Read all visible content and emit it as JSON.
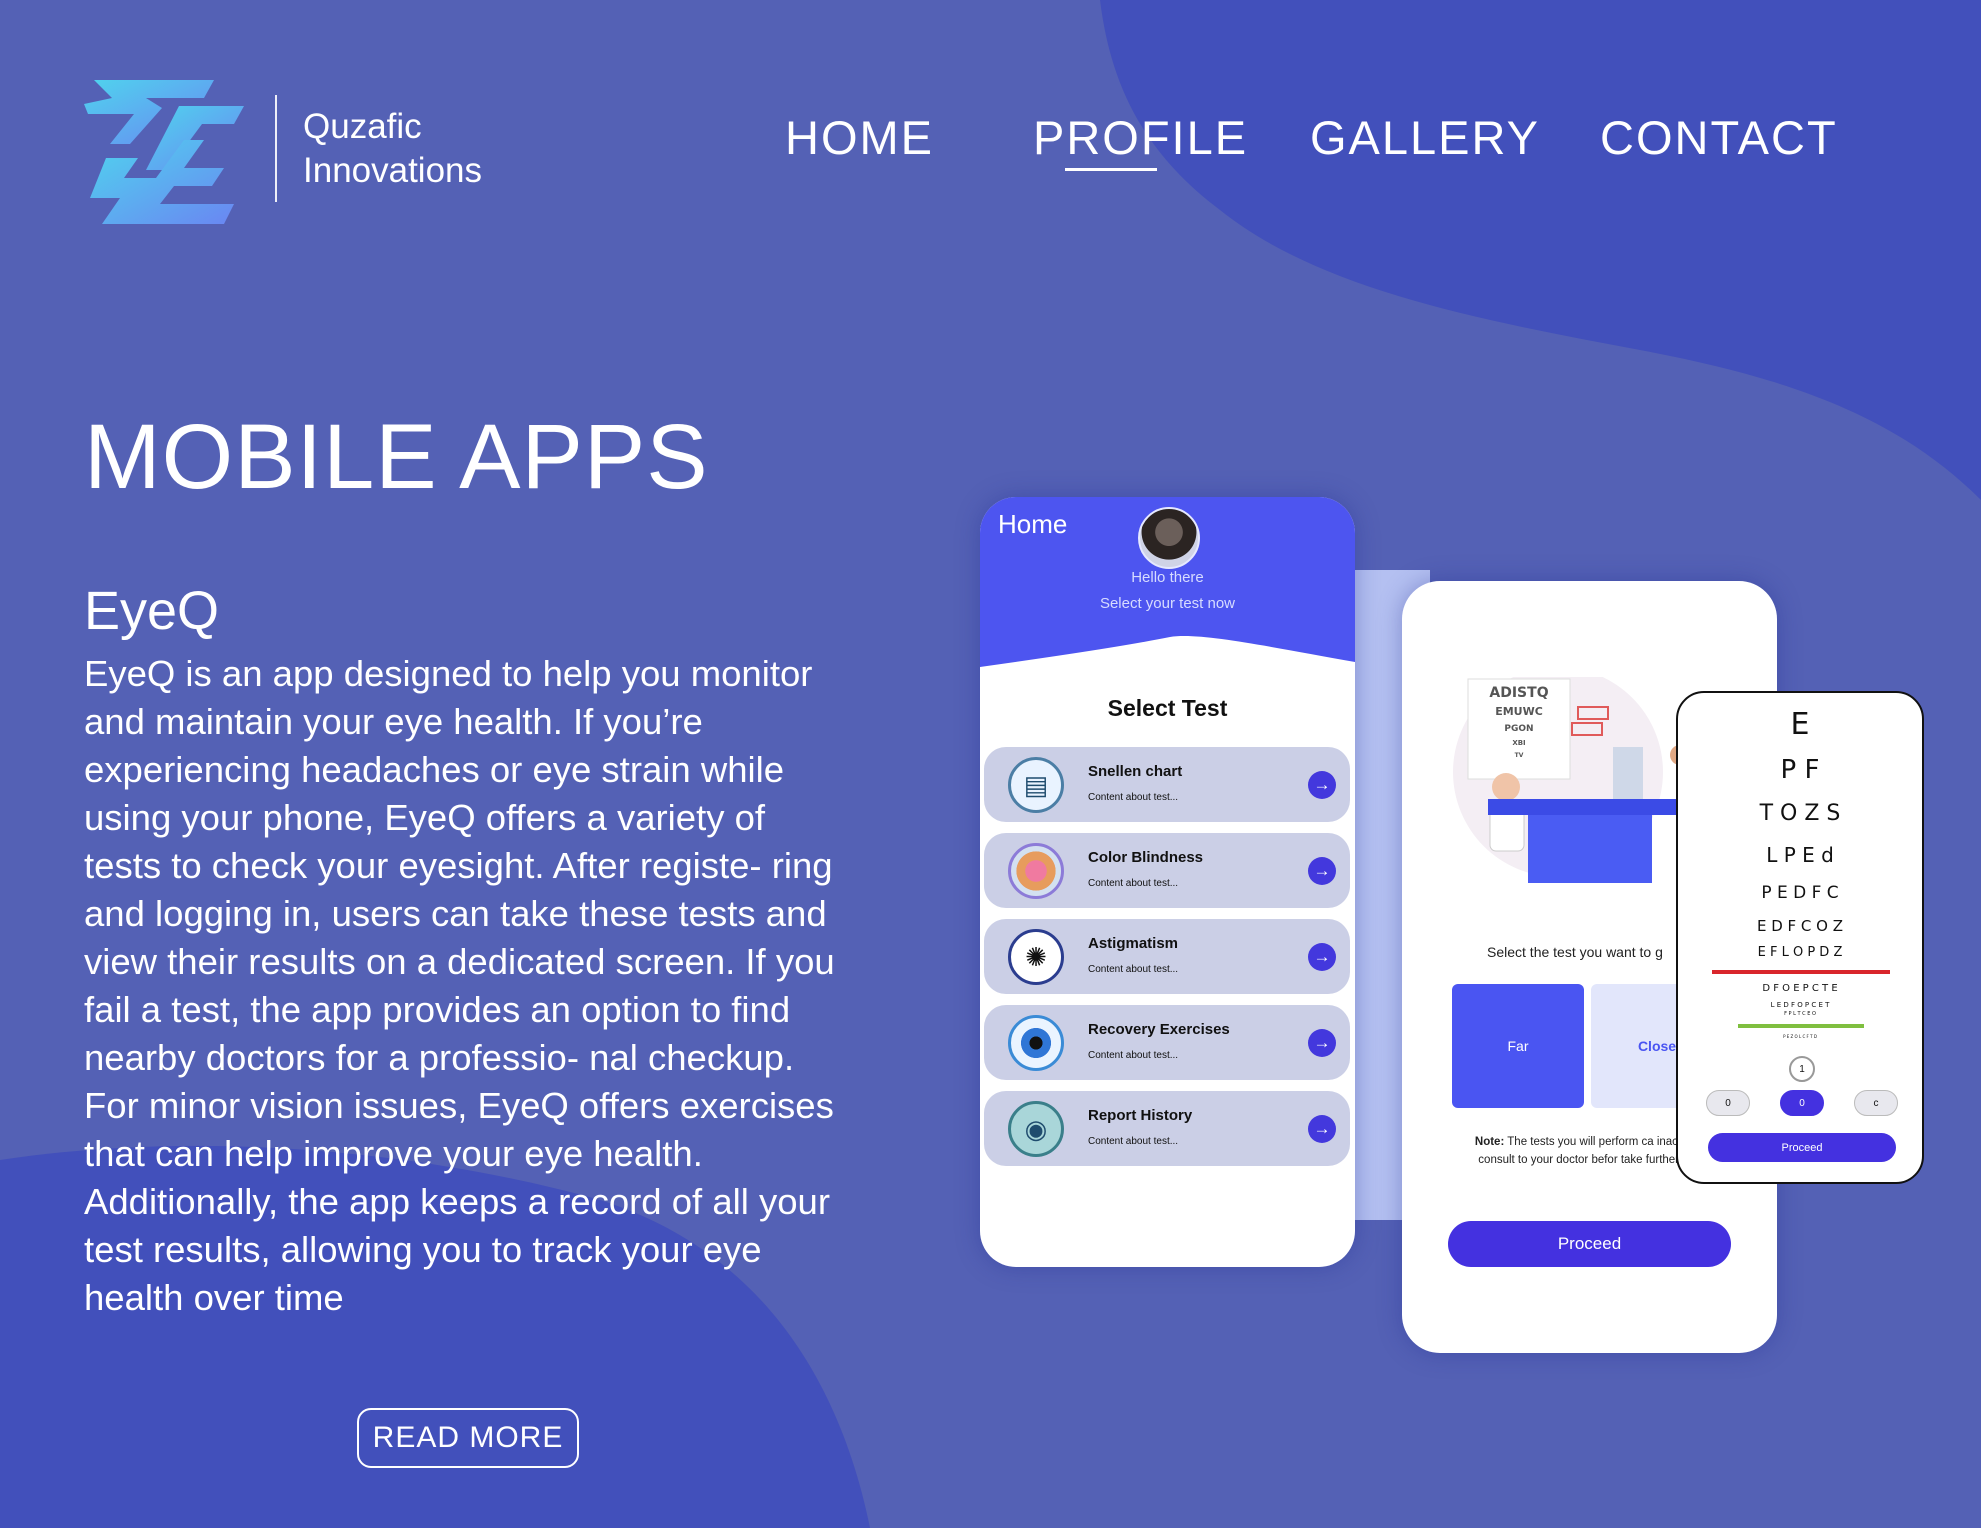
{
  "brand": {
    "line1": "Quzafic",
    "line2": "Innovations",
    "logo_icon": "qz-logo-icon"
  },
  "nav": {
    "home": "HOME",
    "profile": "PROFILE",
    "gallery": "GALLERY",
    "contact": "CONTACT",
    "active": "PROFILE"
  },
  "section": {
    "title": "MOBILE APPS",
    "app_name": "EyeQ",
    "description": "EyeQ is an app designed to help you monitor and maintain your eye health. If you’re experiencing headaches or eye strain while using your phone, EyeQ offers a variety of tests to check your eyesight. After registe- ring and logging in, users can take these tests and view their results on a dedicated screen. If you fail a test, the app provides an option to find nearby doctors for a professio- nal checkup. For minor vision issues, EyeQ offers exercises that can help improve your eye health. Additionally, the app keeps a record of all your test results, allowing you to track your eye health over time",
    "read_more": "READ MORE"
  },
  "phone1": {
    "title": "Home",
    "hello": "Hello there",
    "subtitle": "Select your test now",
    "select_heading": "Select Test",
    "tests": [
      {
        "name": "Snellen chart",
        "sub": "Content about test...",
        "icon": "snellen-chart-icon"
      },
      {
        "name": "Color Blindness",
        "sub": "Content about test...",
        "icon": "color-blindness-icon"
      },
      {
        "name": "Astigmatism",
        "sub": "Content about test...",
        "icon": "astigmatism-icon"
      },
      {
        "name": "Recovery Exercises",
        "sub": "Content about test...",
        "icon": "eye-icon"
      },
      {
        "name": "Report History",
        "sub": "Content about test...",
        "icon": "report-icon"
      }
    ]
  },
  "phone2": {
    "chart_letters": [
      "ADISTQ",
      "EMUWC",
      "PGON",
      "XBI",
      "TV"
    ],
    "select_text": "Select the test you want to g",
    "far": "Far",
    "close": "Close",
    "note_label": "Note:",
    "note_text": "The tests you will perform ca inaccurate, consult to your doctor befor take further steps",
    "proceed": "Proceed"
  },
  "phone3": {
    "rows": [
      "E",
      "P F",
      "T O Z S",
      "L P E d",
      "P E D F C",
      "E D F C O Z",
      "E F L O P D Z",
      "D F O E P C T E",
      "L E D F O P C E T",
      "F P L T C E O",
      "P E Z O L C F T D"
    ],
    "dial": "1",
    "options": [
      "0",
      "0",
      "c"
    ],
    "proceed": "Proceed",
    "line_colors": {
      "red": "#d9262c",
      "green": "#7fbf3f"
    }
  },
  "colors": {
    "background": "#5461b5",
    "accent": "#4431e0",
    "header_blue": "#4d55f0"
  }
}
